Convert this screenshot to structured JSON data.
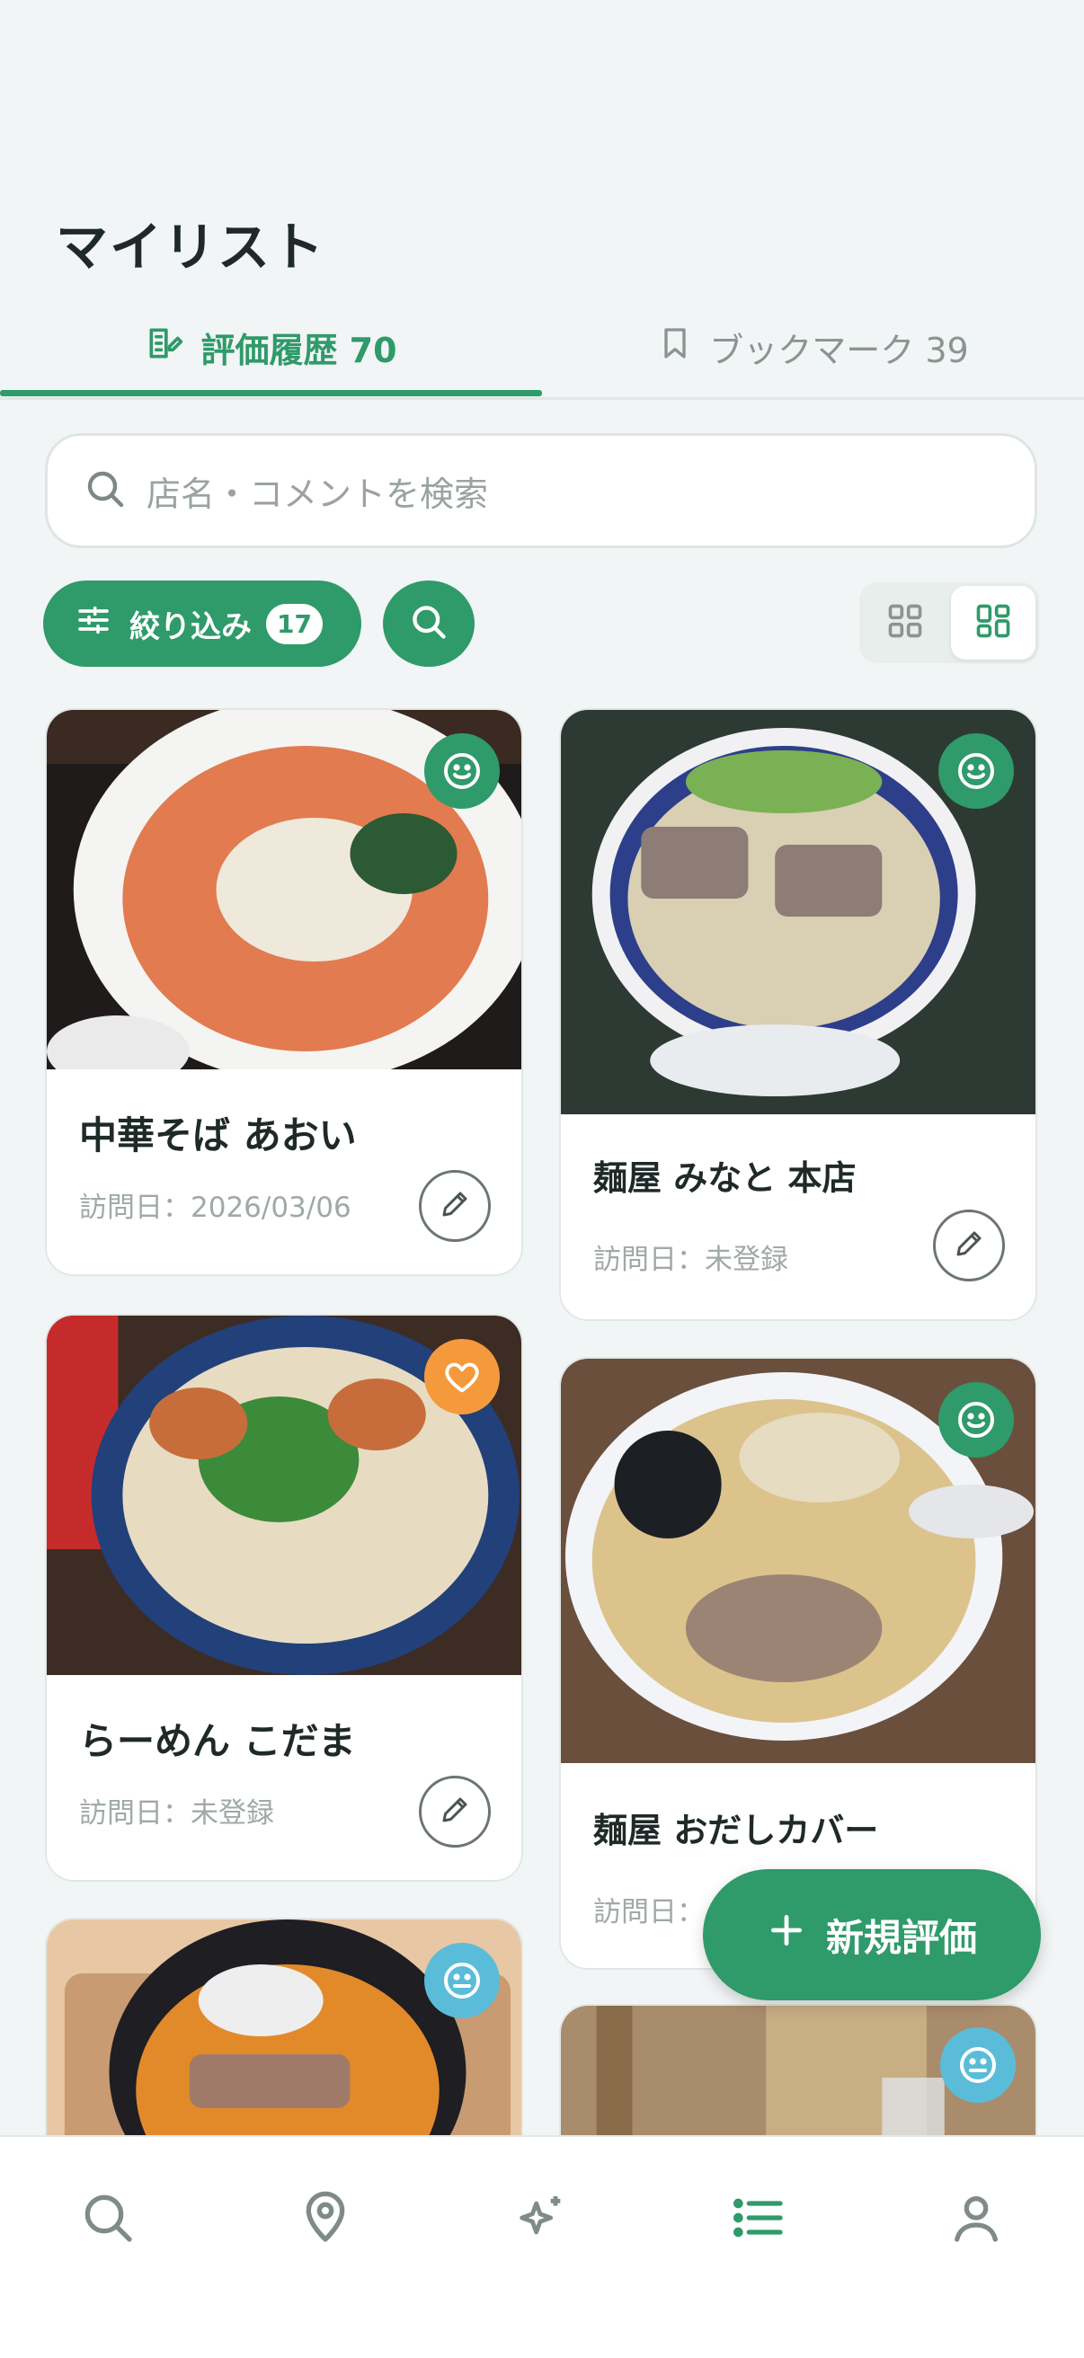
{
  "header": {
    "title": "マイリスト"
  },
  "tabs": [
    {
      "label": "評価履歴 70",
      "icon": "edit-note-icon",
      "active": true
    },
    {
      "label": "ブックマーク 39",
      "icon": "bookmark-icon",
      "active": false
    }
  ],
  "search": {
    "placeholder": "店名・コメントを検索",
    "icon": "search-icon"
  },
  "filter": {
    "label": "絞り込み",
    "count": "17"
  },
  "cards": [
    {
      "name": "中華そば あおい",
      "date": "訪問日：2026/03/06",
      "mood": "smile-icon",
      "mood_color": "#2f9a6a"
    },
    {
      "name": "麺屋 みなと 本店",
      "date": "訪問日：未登録",
      "mood": "smile-icon",
      "mood_color": "#2f9a6a"
    },
    {
      "name": "らーめん こだま",
      "date": "訪問日：未登録",
      "mood": "heart-icon",
      "mood_color": "#f59a3c"
    },
    {
      "name": "麺屋 おだしカバー",
      "date": "訪問日：",
      "mood": "smile-icon",
      "mood_color": "#2f9a6a"
    },
    {
      "name": "",
      "date": "",
      "mood": "neutral-face-icon",
      "mood_color": "#5bbcd9"
    },
    {
      "name": "",
      "date": "",
      "mood": "neutral-face-icon",
      "mood_color": "#5bbcd9"
    }
  ],
  "fab": {
    "label": "新規評価"
  },
  "nav": [
    {
      "icon": "search-icon",
      "active": false
    },
    {
      "icon": "map-pin-icon",
      "active": false
    },
    {
      "icon": "sparkle-icon",
      "active": false
    },
    {
      "icon": "list-icon",
      "active": true
    },
    {
      "icon": "user-icon",
      "active": false
    }
  ],
  "colors": {
    "accent": "#2f9a6a",
    "background": "#f2f5f5",
    "heart": "#f59a3c",
    "neutral": "#5bbcd9"
  }
}
